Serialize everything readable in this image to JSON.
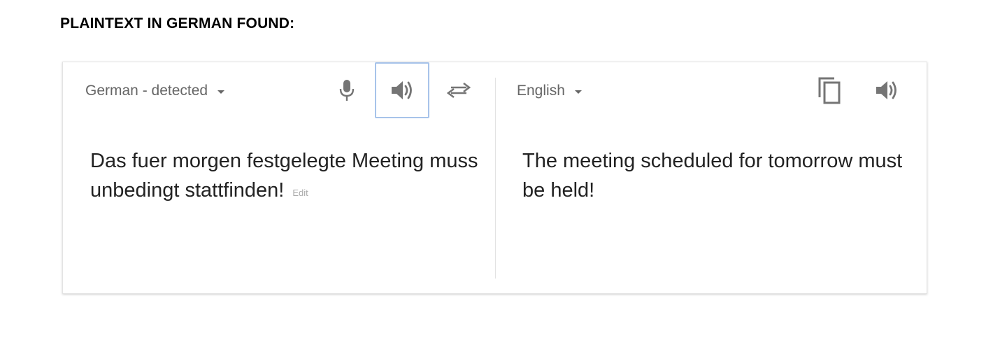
{
  "heading": "PLAINTEXT IN GERMAN FOUND:",
  "translator": {
    "source": {
      "language_label": "German - detected",
      "text": "Das fuer morgen festgelegte Meeting muss unbedingt stattfinden!",
      "edit_label": "Edit"
    },
    "target": {
      "language_label": "English",
      "text": "The meeting scheduled for tomorrow must be held!"
    },
    "icons": {
      "microphone": "microphone-icon",
      "source_speaker": "speaker-icon",
      "swap": "swap-languages-icon",
      "copy": "copy-icon",
      "target_speaker": "speaker-icon"
    },
    "colors": {
      "icon_gray": "#757575",
      "focus_border": "#a7c3ea",
      "muted_text": "#666666"
    }
  }
}
